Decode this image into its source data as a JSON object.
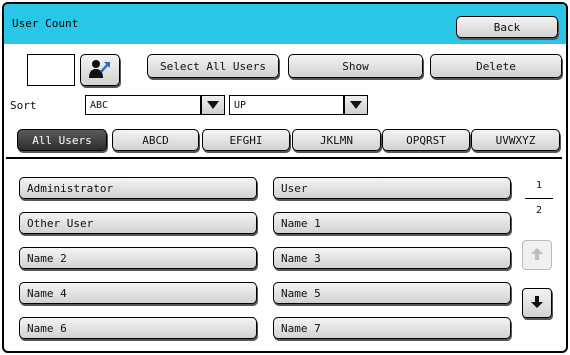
{
  "header": {
    "title": "User Count",
    "back_label": "Back"
  },
  "toolbar": {
    "select_all_label": "Select All Users",
    "show_label": "Show",
    "delete_label": "Delete"
  },
  "sort": {
    "label": "Sort",
    "field_value": "ABC",
    "order_value": "UP"
  },
  "filter_tabs": [
    "All Users",
    "ABCD",
    "EFGHI",
    "JKLMN",
    "OPQRST",
    "UVWXYZ"
  ],
  "users_left": [
    "Administrator",
    "Other User",
    "Name 2",
    "Name 4",
    "Name 6"
  ],
  "users_right": [
    "User",
    "Name 1",
    "Name 3",
    "Name 5",
    "Name 7"
  ],
  "pagination": {
    "current": "1",
    "total": "2"
  },
  "icons": {
    "user_select": "user-with-arrow-icon",
    "page_up": "arrow-up-icon",
    "page_down": "arrow-down-icon"
  },
  "colors": {
    "title_bar": "#29c6e8",
    "active_tab": "#3a3a3a"
  }
}
